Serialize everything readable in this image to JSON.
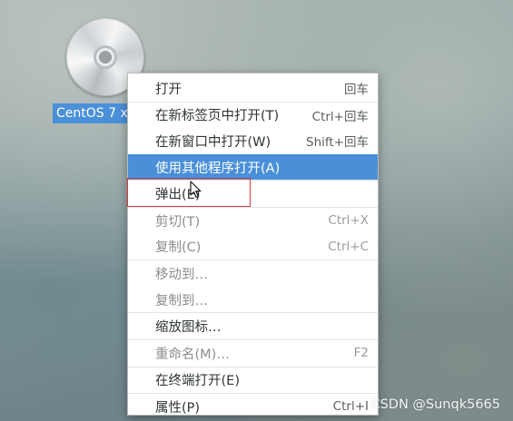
{
  "desktop": {
    "icon_label": "CentOS 7 x86_64"
  },
  "menu": {
    "items": [
      {
        "label": "打开",
        "shortcut": "回车",
        "state": "normal"
      },
      {
        "label": "在新标签页中打开(T)",
        "shortcut": "Ctrl+回车",
        "state": "normal"
      },
      {
        "label": "在新窗口中打开(W)",
        "shortcut": "Shift+回车",
        "state": "normal"
      },
      {
        "label": "使用其他程序打开(A)",
        "shortcut": "",
        "state": "highlighted"
      },
      {
        "label": "弹出(E)",
        "shortcut": "",
        "state": "normal"
      },
      {
        "label": "剪切(T)",
        "shortcut": "Ctrl+X",
        "state": "disabled"
      },
      {
        "label": "复制(C)",
        "shortcut": "Ctrl+C",
        "state": "disabled"
      },
      {
        "label": "移动到…",
        "shortcut": "",
        "state": "disabled"
      },
      {
        "label": "复制到…",
        "shortcut": "",
        "state": "disabled"
      },
      {
        "label": "缩放图标…",
        "shortcut": "",
        "state": "normal"
      },
      {
        "label": "重命名(M)…",
        "shortcut": "F2",
        "state": "disabled"
      },
      {
        "label": "在终端打开(E)",
        "shortcut": "",
        "state": "normal"
      },
      {
        "label": "属性(P)",
        "shortcut": "Ctrl+I",
        "state": "normal"
      }
    ]
  },
  "watermark": "CSDN @Sunqk5665",
  "colors": {
    "highlight": "#4a90d9",
    "annotation_box": "#d63b3b"
  }
}
